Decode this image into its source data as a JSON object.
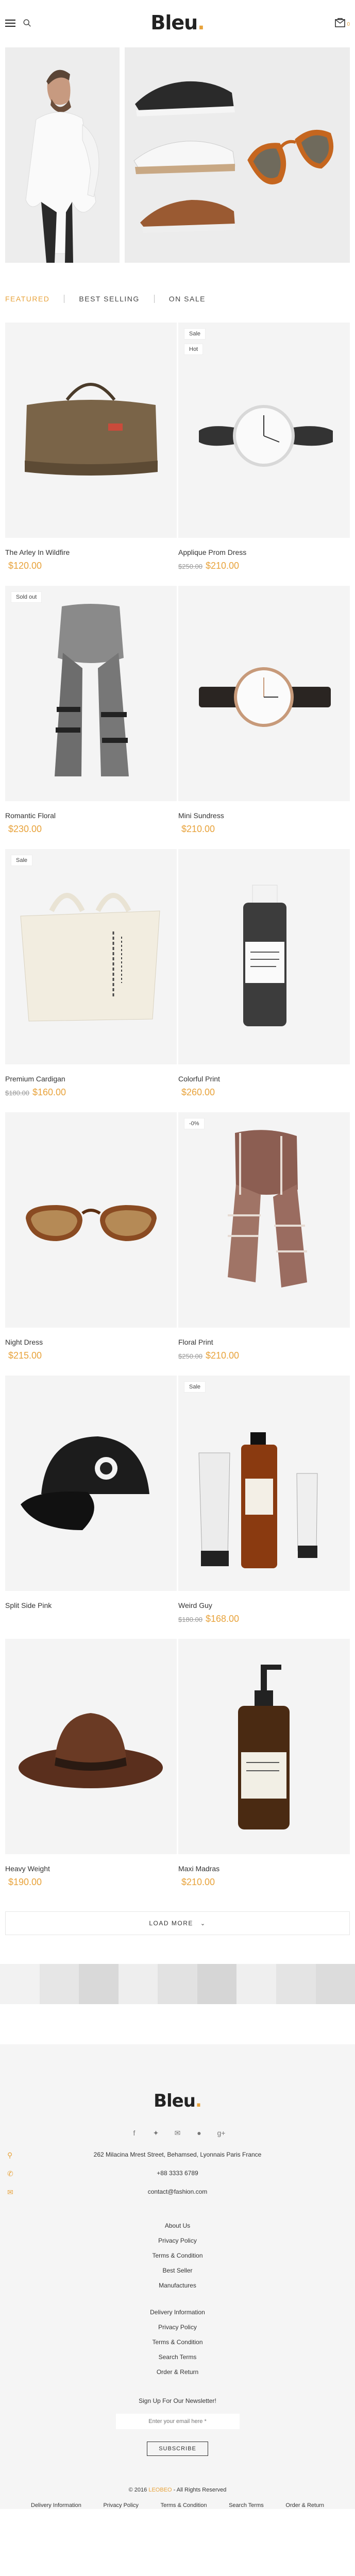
{
  "header": {
    "logo_text": "Bleu",
    "logo_dot": ".",
    "cart_count": "0",
    "accent": "#e8a33c"
  },
  "tabs": [
    "Featured",
    "Best Selling",
    "On Sale"
  ],
  "products": [
    {
      "name": "The Arley In Wildfire",
      "price": "$120.00",
      "old_price": "",
      "badges": [],
      "image": "duffle-bag-icon"
    },
    {
      "name": "Applique Prom Dress",
      "price": "$210.00",
      "old_price": "$250.00",
      "badges": [
        "Sale",
        "Hot"
      ],
      "image": "watch-icon"
    },
    {
      "name": "Romantic Floral",
      "price": "$230.00",
      "old_price": "",
      "badges": [
        "Sold out"
      ],
      "image": "scarf-icon"
    },
    {
      "name": "Mini Sundress",
      "price": "$210.00",
      "old_price": "",
      "badges": [],
      "image": "watch-icon"
    },
    {
      "name": "Premium Cardigan",
      "price": "$160.00",
      "old_price": "$180.00",
      "badges": [
        "Sale"
      ],
      "image": "tote-bag-icon"
    },
    {
      "name": "Colorful Print",
      "price": "$260.00",
      "old_price": "",
      "badges": [],
      "image": "cleanser-bottle-icon"
    },
    {
      "name": "Night Dress",
      "price": "$215.00",
      "old_price": "",
      "badges": [],
      "image": "sunglasses-icon"
    },
    {
      "name": "Floral Print",
      "price": "$210.00",
      "old_price": "$250.00",
      "badges": [
        "-0%"
      ],
      "image": "plaid-scarf-icon"
    },
    {
      "name": "Split Side Pink",
      "price": "",
      "old_price": "",
      "badges": [],
      "image": "cap-icon"
    },
    {
      "name": "Weird Guy",
      "price": "$168.00",
      "old_price": "$180.00",
      "badges": [
        "Sale"
      ],
      "image": "grooming-set-icon"
    },
    {
      "name": "Heavy Weight",
      "price": "$190.00",
      "old_price": "",
      "badges": [],
      "image": "hat-icon"
    },
    {
      "name": "Maxi Madras",
      "price": "$210.00",
      "old_price": "",
      "badges": [],
      "image": "pump-bottle-icon"
    }
  ],
  "load_more": "LOAD MORE",
  "footer": {
    "logo_text": "Bleu",
    "logo_dot": ".",
    "social": [
      "facebook-icon",
      "twitter-icon",
      "email-icon",
      "pinterest-icon",
      "google-plus-icon"
    ],
    "address": "262 Milacina Mrest Street, Behamsed, Lyonnais Paris France",
    "phone": "+88 3333 6789",
    "email": "contact@fashion.com",
    "links1": [
      "About Us",
      "Privacy Policy",
      "Terms & Condition",
      "Best Seller",
      "Manufactures"
    ],
    "links2": [
      "Delivery Information",
      "Privacy Policy",
      "Terms & Condition",
      "Search Terms",
      "Order & Return"
    ],
    "newsletter_label": "Sign Up For Our Newsletter!",
    "newsletter_placeholder": "Enter your email here *",
    "subscribe": "SUBSCRIBE",
    "copyright_pre": "© 2016",
    "copyright_brand": "LEOBEO",
    "copyright_post": " - All Rights Reserved",
    "bottom_links": [
      "Delivery Information",
      "Privacy Policy",
      "Terms & Condition",
      "Search Terms",
      "Order & Return"
    ]
  }
}
